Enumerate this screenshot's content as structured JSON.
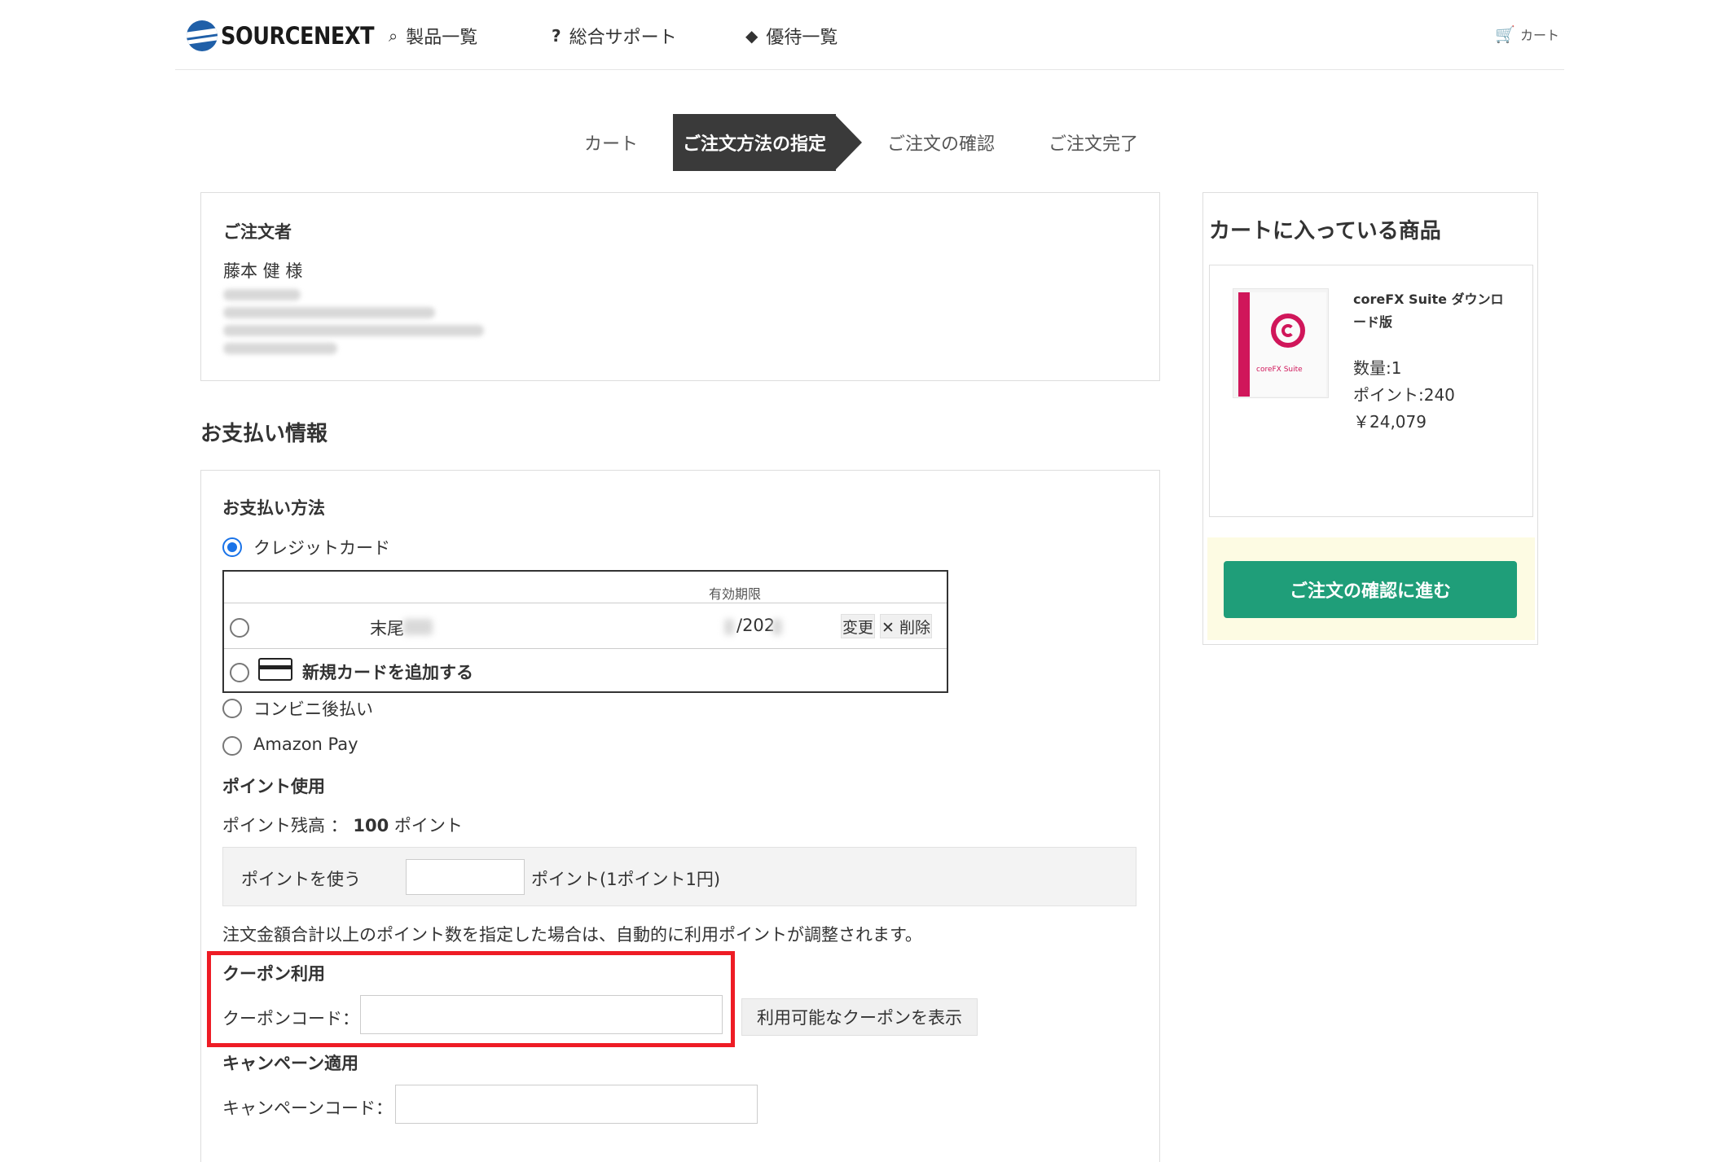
{
  "header": {
    "logo_text": "SOURCENEXT",
    "nav": [
      {
        "label": "製品一覧",
        "icon": "search-icon"
      },
      {
        "label": "総合サポート",
        "icon": "question-icon"
      },
      {
        "label": "優待一覧",
        "icon": "tag-icon"
      }
    ],
    "cart_label": "カート",
    "cart_icon": "cart-icon"
  },
  "steps": [
    "カート",
    "ご注文方法の指定",
    "ご注文の確認",
    "ご注文完了"
  ],
  "orderer": {
    "heading": "ご注文者",
    "name": "藤本 健 様"
  },
  "payment": {
    "section_title": "お支払い情報",
    "method_heading": "お支払い方法",
    "options": {
      "credit": "クレジットカード",
      "conbini": "コンビニ後払い",
      "amazon": "Amazon Pay"
    },
    "card_table": {
      "expiry_header": "有効期限",
      "tail_label": "末尾",
      "expiry_value": "/202",
      "change_btn": "変更",
      "delete_btn": "✕ 削除",
      "add_card": "新規カードを追加する"
    }
  },
  "points": {
    "heading": "ポイント使用",
    "balance_label": "ポイント残高 ：",
    "balance_value": "100",
    "balance_unit": "ポイント",
    "use_label": "ポイントを使う",
    "use_value": "",
    "use_unit": "ポイント(1ポイント1円)",
    "note": "注文金額合計以上のポイント数を指定した場合は、自動的に利用ポイントが調整されます。"
  },
  "coupon": {
    "heading": "クーポン利用",
    "code_label": "クーポンコード：",
    "code_value": "",
    "show_btn": "利用可能なクーポンを表示"
  },
  "campaign": {
    "heading": "キャンペーン適用",
    "code_label": "キャンペーンコード：",
    "code_value": ""
  },
  "cart_panel": {
    "title": "カートに入っている商品",
    "product_name": "coreFX Suite ダウンロード版",
    "quantity": "数量:1",
    "points": "ポイント:240",
    "price": "￥24,079",
    "box_label": "coreFX Suite",
    "confirm_btn": "ご注文の確認に進む"
  },
  "colors": {
    "accent_green": "#1f9e79",
    "highlight_red": "#ee1c25",
    "radio_blue": "#1a73e8",
    "step_active": "#3a3a3a",
    "product_magenta": "#d0165a"
  }
}
